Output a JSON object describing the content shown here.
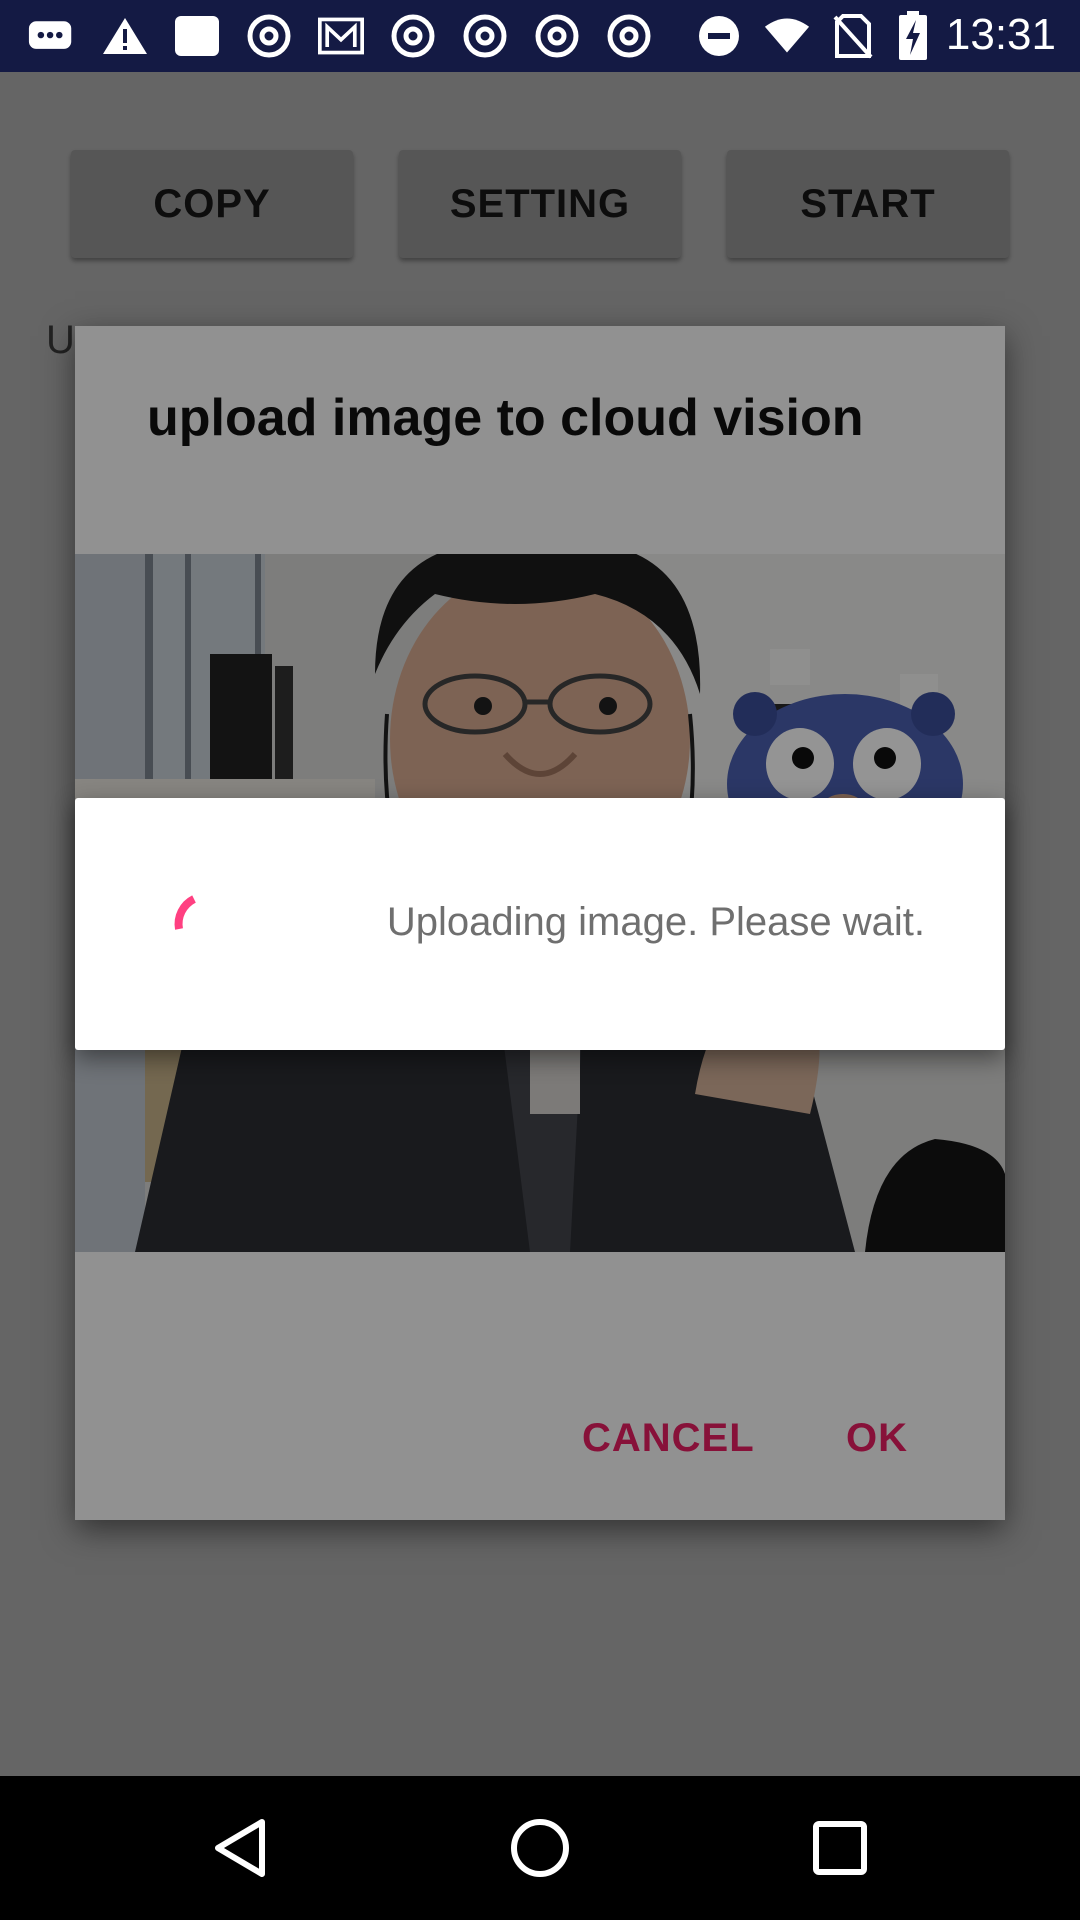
{
  "status_bar": {
    "time": "13:31",
    "icons": [
      "chat-bubble-icon",
      "warning-icon",
      "square-notification-icon",
      "chrome-icon",
      "gmail-icon",
      "chrome-icon",
      "chrome-icon",
      "chrome-icon",
      "chrome-icon",
      "do-not-disturb-icon",
      "wifi-icon",
      "no-sim-icon",
      "battery-charging-icon"
    ]
  },
  "app": {
    "buttons": [
      "COPY",
      "SETTING",
      "START"
    ],
    "peek_text": "U"
  },
  "dialog": {
    "title": "upload image to cloud vision",
    "cancel_label": "CANCEL",
    "ok_label": "OK"
  },
  "progress": {
    "message": "Uploading image. Please wait.",
    "accent_color": "#ff4081"
  },
  "nav_bar": {
    "icons": [
      "back-icon",
      "home-icon",
      "recents-icon"
    ]
  }
}
